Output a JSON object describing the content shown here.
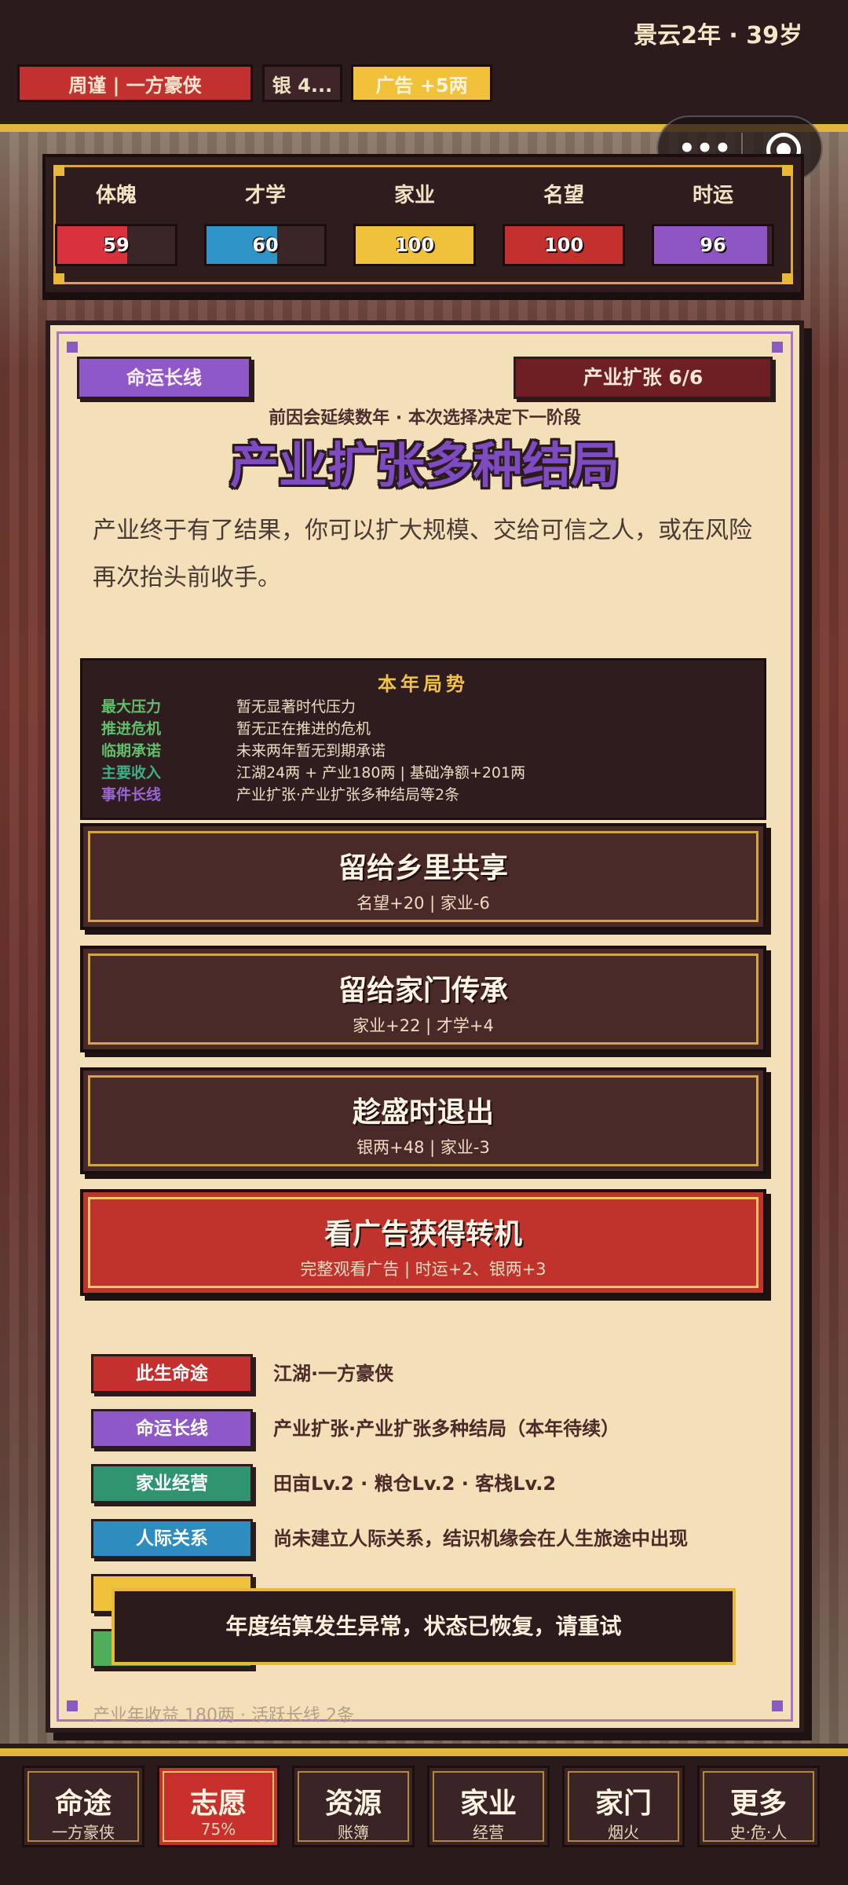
{
  "header": {
    "year_age": "景云2年 · 39岁",
    "name_chip": "周谨 | 一方豪侠",
    "silver_chip": "银 4...",
    "ad_chip": "广告 +5两"
  },
  "stats": [
    {
      "label": "体魄",
      "value": "59",
      "fill": 0.59,
      "color": "#d9323c"
    },
    {
      "label": "才学",
      "value": "60",
      "fill": 0.6,
      "color": "#2e94c8"
    },
    {
      "label": "家业",
      "value": "100",
      "fill": 1.0,
      "color": "#f0c23c"
    },
    {
      "label": "名望",
      "value": "100",
      "fill": 1.0,
      "color": "#c3302e"
    },
    {
      "label": "时运",
      "value": "96",
      "fill": 0.96,
      "color": "#8e55c5"
    }
  ],
  "card": {
    "tag_left": "命运长线",
    "tag_right": "产业扩张 6/6",
    "kicker": "前因会延续数年 · 本次选择决定下一阶段",
    "headline": "产业扩张多种结局",
    "desc": "产业终于有了结果，你可以扩大规模、交给可信之人，或在风险再次抬头前收手。"
  },
  "situation": {
    "title": "本年局势",
    "rows": [
      {
        "key": "最大压力",
        "value": "暂无显著时代压力",
        "color": "#5fbf6a"
      },
      {
        "key": "推进危机",
        "value": "暂无正在推进的危机",
        "color": "#5fbf6a"
      },
      {
        "key": "临期承诺",
        "value": "未来两年暂无到期承诺",
        "color": "#5fbf6a"
      },
      {
        "key": "主要收入",
        "value": "江湖24两 + 产业180两 | 基础净额+201两",
        "color": "#3fae86"
      },
      {
        "key": "事件长线",
        "value": "产业扩张·产业扩张多种结局等2条",
        "color": "#9a66d6"
      }
    ]
  },
  "choices": [
    {
      "title": "留给乡里共享",
      "sub": "名望+20 | 家业-6"
    },
    {
      "title": "留给家门传承",
      "sub": "家业+22 | 才学+4"
    },
    {
      "title": "趁盛时退出",
      "sub": "银两+48 | 家业-3"
    },
    {
      "title": "看广告获得转机",
      "sub": "完整观看广告 | 时运+2、银两+3"
    }
  ],
  "info": [
    {
      "badge": "此生命途",
      "text": "江湖·一方豪侠",
      "color": "#c3302e"
    },
    {
      "badge": "命运长线",
      "text": "产业扩张·产业扩张多种结局（本年待续）",
      "color": "#8e58c8"
    },
    {
      "badge": "家业经营",
      "text": "田亩Lv.2 · 粮仓Lv.2 · 客栈Lv.2",
      "color": "#2f9470"
    },
    {
      "badge": "人际关系",
      "text": "尚未建立人际关系，结识机缘会在人生旅途中出现",
      "color": "#2e8cbf"
    },
    {
      "badge": "",
      "text": "",
      "color": "#f0c23c"
    },
    {
      "badge": "",
      "text": "",
      "color": "#4fae5a"
    }
  ],
  "footer_note": "产业年收益 180两 · 活跃长线 2条",
  "toast": "年度结算发生异常，状态已恢复，请重试",
  "nav": [
    {
      "label": "命途",
      "sub": "一方豪侠"
    },
    {
      "label": "志愿",
      "sub": "75%"
    },
    {
      "label": "资源",
      "sub": "账簿"
    },
    {
      "label": "家业",
      "sub": "经营"
    },
    {
      "label": "家门",
      "sub": "烟火"
    },
    {
      "label": "更多",
      "sub": "史·危·人"
    }
  ]
}
